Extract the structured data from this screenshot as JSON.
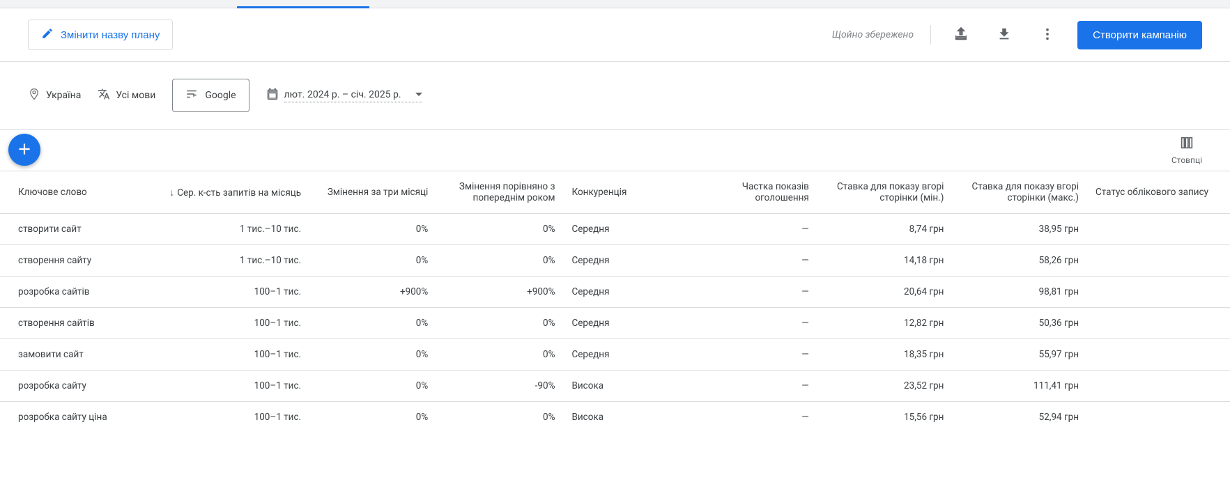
{
  "header": {
    "edit_plan_label": "Змінити назву плану",
    "saved_text": "Щойно збережено",
    "create_campaign_label": "Створити кампанію"
  },
  "filters": {
    "location": "Україна",
    "language": "Усі мови",
    "network": "Google",
    "date_range": "лют. 2024 р. – січ. 2025 р."
  },
  "columns_label": "Стовпці",
  "table": {
    "headers": {
      "keyword": "Ключове слово",
      "avg_searches": "Сер. к-сть запитів на місяць",
      "change_3m": "Змінення за три місяці",
      "change_yoy": "Змінення порівняно з попереднім роком",
      "competition": "Конкуренція",
      "impression_share": "Частка показів оголошення",
      "bid_low": "Ставка для показу вгорі сторінки (мін.)",
      "bid_high": "Ставка для показу вгорі сторінки (макс.)",
      "account_status": "Статус облікового запису"
    },
    "rows": [
      {
        "keyword": "створити сайт",
        "avg_searches": "1 тис.–10 тис.",
        "change_3m": "0%",
        "change_yoy": "0%",
        "competition": "Середня",
        "impression_share": "—",
        "bid_low": "8,74 грн",
        "bid_high": "38,95 грн",
        "account_status": ""
      },
      {
        "keyword": "створення сайту",
        "avg_searches": "1 тис.–10 тис.",
        "change_3m": "0%",
        "change_yoy": "0%",
        "competition": "Середня",
        "impression_share": "—",
        "bid_low": "14,18 грн",
        "bid_high": "58,26 грн",
        "account_status": ""
      },
      {
        "keyword": "розробка сайтів",
        "avg_searches": "100–1 тис.",
        "change_3m": "+900%",
        "change_yoy": "+900%",
        "competition": "Середня",
        "impression_share": "—",
        "bid_low": "20,64 грн",
        "bid_high": "98,81 грн",
        "account_status": ""
      },
      {
        "keyword": "створення сайтів",
        "avg_searches": "100–1 тис.",
        "change_3m": "0%",
        "change_yoy": "0%",
        "competition": "Середня",
        "impression_share": "—",
        "bid_low": "12,82 грн",
        "bid_high": "50,36 грн",
        "account_status": ""
      },
      {
        "keyword": "замовити сайт",
        "avg_searches": "100–1 тис.",
        "change_3m": "0%",
        "change_yoy": "0%",
        "competition": "Середня",
        "impression_share": "—",
        "bid_low": "18,35 грн",
        "bid_high": "55,97 грн",
        "account_status": ""
      },
      {
        "keyword": "розробка сайту",
        "avg_searches": "100–1 тис.",
        "change_3m": "0%",
        "change_yoy": "-90%",
        "competition": "Висока",
        "impression_share": "—",
        "bid_low": "23,52 грн",
        "bid_high": "111,41 грн",
        "account_status": ""
      },
      {
        "keyword": "розробка сайту ціна",
        "avg_searches": "100–1 тис.",
        "change_3m": "0%",
        "change_yoy": "0%",
        "competition": "Висока",
        "impression_share": "—",
        "bid_low": "15,56 грн",
        "bid_high": "52,94 грн",
        "account_status": ""
      }
    ]
  }
}
